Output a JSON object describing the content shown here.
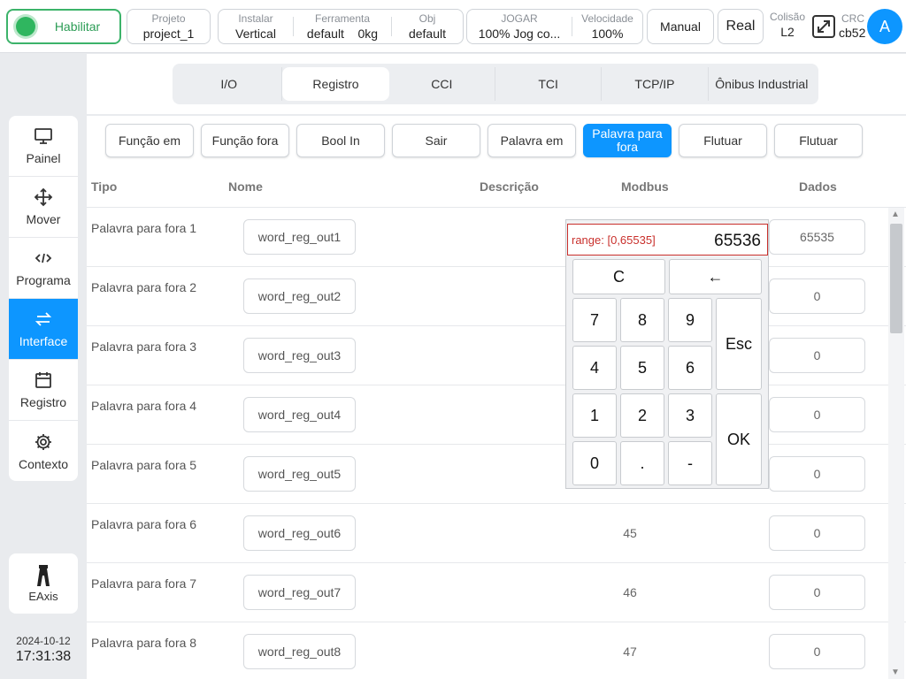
{
  "topbar": {
    "enable_label": "Habilitar",
    "project": {
      "label": "Projeto",
      "value": "project_1"
    },
    "install": {
      "label": "Instalar",
      "value": "Vertical"
    },
    "tool": {
      "label": "Ferramenta",
      "value": "default",
      "weight": "0kg"
    },
    "obj": {
      "label": "Obj",
      "value": "default"
    },
    "jog": {
      "label": "JOGAR",
      "value": "100%  Jog co..."
    },
    "speed": {
      "label": "Velocidade",
      "value": "100%"
    },
    "manual_label": "Manual",
    "real_label": "Real",
    "collision": {
      "label": "Colisão",
      "value": "L2"
    },
    "crc": {
      "label": "CRC",
      "value": "cb52"
    },
    "avatar_letter": "A"
  },
  "tabs": [
    "I/O",
    "Registro",
    "CCI",
    "TCI",
    "TCP/IP",
    "Ônibus Industrial"
  ],
  "active_tab": "Registro",
  "sidebar": {
    "items": [
      {
        "label": "Painel",
        "icon": "monitor-icon"
      },
      {
        "label": "Mover",
        "icon": "move-icon"
      },
      {
        "label": "Programa",
        "icon": "code-icon"
      },
      {
        "label": "Interface",
        "icon": "swap-icon"
      },
      {
        "label": "Registro",
        "icon": "calendar-icon"
      },
      {
        "label": "Contexto",
        "icon": "gear-icon"
      }
    ],
    "active": "Interface",
    "eaxis_label": "EAxis",
    "date": "2024-10-12",
    "time": "17:31:38"
  },
  "subtabs": [
    "Função em",
    "Função fora",
    "Bool In",
    "Sair",
    "Palavra em",
    "Palavra para fora",
    "Flutuar",
    "Flutuar"
  ],
  "active_subtab": "Palavra para fora",
  "table": {
    "headers": {
      "tipo": "Tipo",
      "nome": "Nome",
      "descricao": "Descrição",
      "modbus": "Modbus",
      "dados": "Dados"
    },
    "rows": [
      {
        "tipo": "Palavra para fora 1",
        "nome": "word_reg_out1",
        "modbus": "",
        "dados": "65535"
      },
      {
        "tipo": "Palavra para fora 2",
        "nome": "word_reg_out2",
        "modbus": "",
        "dados": "0"
      },
      {
        "tipo": "Palavra para fora 3",
        "nome": "word_reg_out3",
        "modbus": "",
        "dados": "0"
      },
      {
        "tipo": "Palavra para fora 4",
        "nome": "word_reg_out4",
        "modbus": "",
        "dados": "0"
      },
      {
        "tipo": "Palavra para fora 5",
        "nome": "word_reg_out5",
        "modbus": "",
        "dados": "0"
      },
      {
        "tipo": "Palavra para fora 6",
        "nome": "word_reg_out6",
        "modbus": "45",
        "dados": "0"
      },
      {
        "tipo": "Palavra para fora 7",
        "nome": "word_reg_out7",
        "modbus": "46",
        "dados": "0"
      },
      {
        "tipo": "Palavra para fora 8",
        "nome": "word_reg_out8",
        "modbus": "47",
        "dados": "0"
      }
    ]
  },
  "keypad": {
    "range_text": "range: [0,65535]",
    "value": "65536",
    "keys": {
      "clear": "C",
      "backspace": "←",
      "esc": "Esc",
      "ok": "OK",
      "k7": "7",
      "k8": "8",
      "k9": "9",
      "k4": "4",
      "k5": "5",
      "k6": "6",
      "k1": "1",
      "k2": "2",
      "k3": "3",
      "k0": "0",
      "dot": ".",
      "minus": "-"
    }
  },
  "colors": {
    "accent": "#0d96ff",
    "enable_green": "#2fb65f",
    "error_red": "#c9302c"
  }
}
